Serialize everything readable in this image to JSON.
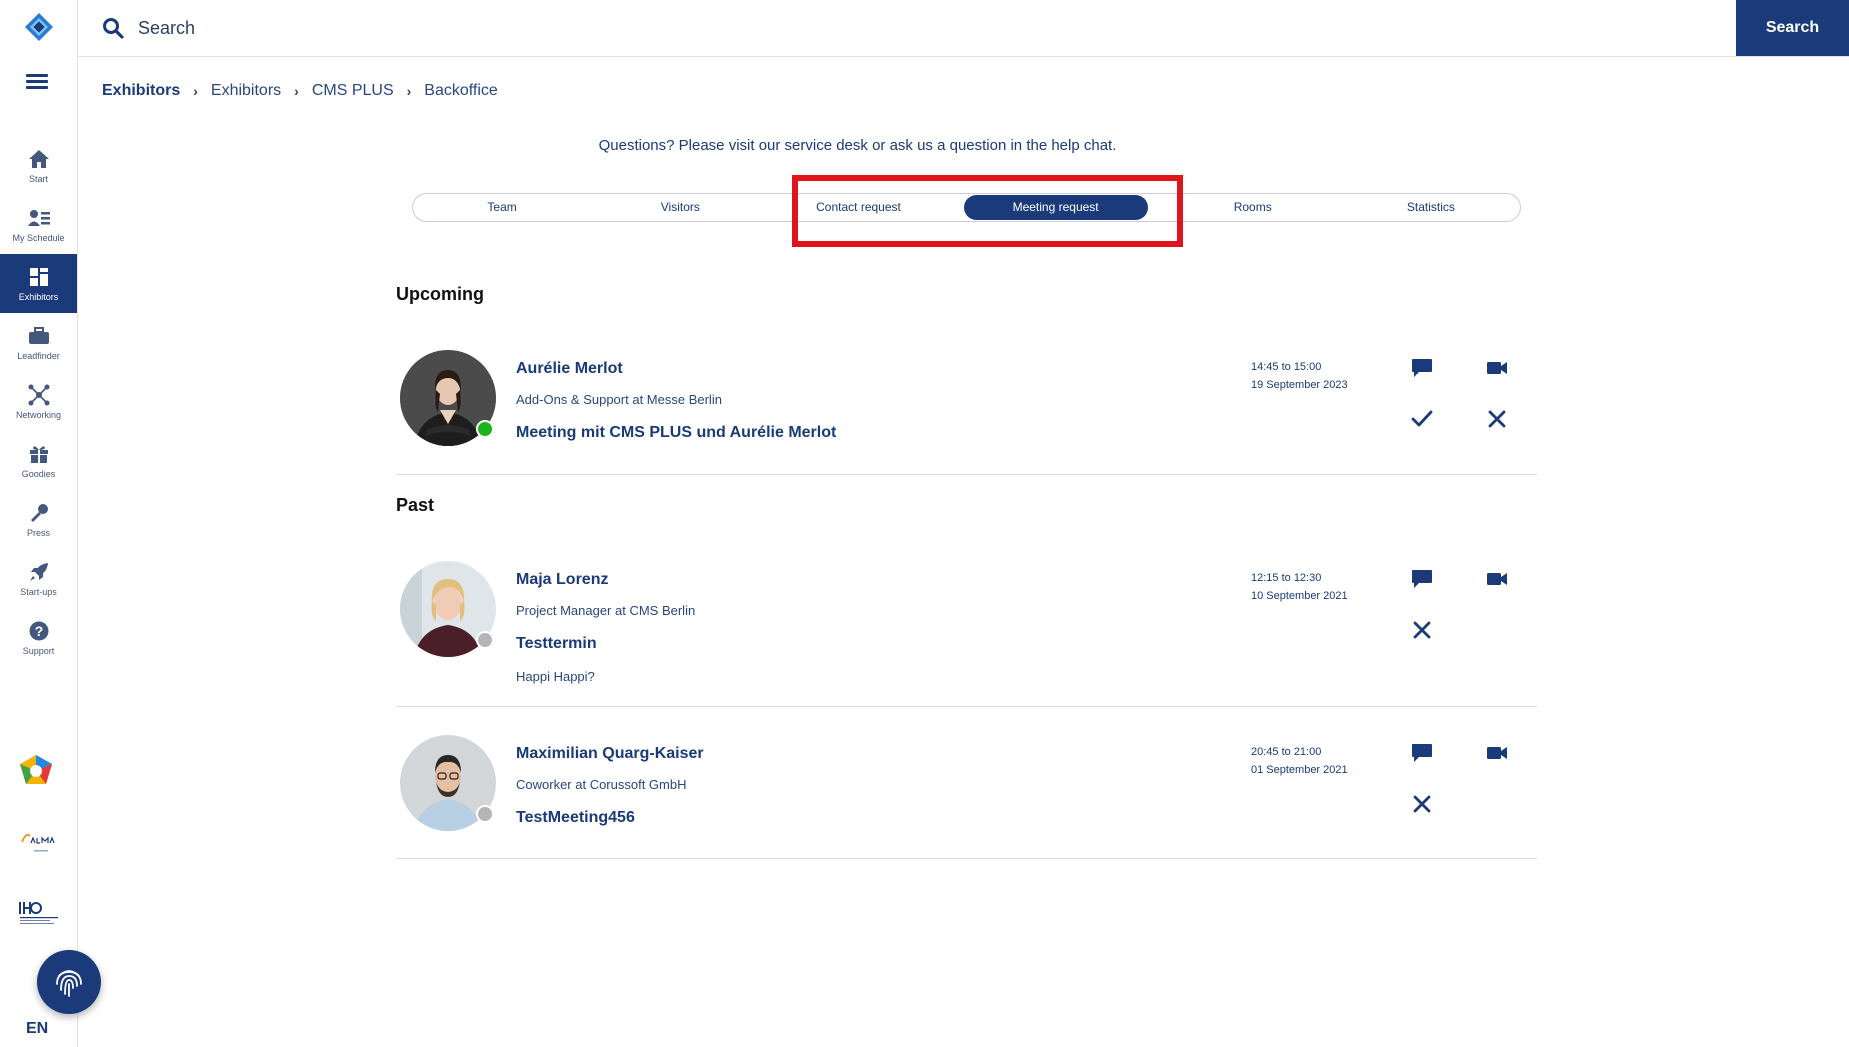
{
  "app": {
    "language": "EN"
  },
  "search": {
    "placeholder": "Search",
    "button_label": "Search"
  },
  "sidebar": {
    "items": [
      {
        "label": "Start",
        "icon": "home-icon"
      },
      {
        "label": "My Schedule",
        "icon": "schedule-icon"
      },
      {
        "label": "Exhibitors",
        "icon": "exhibitors-icon",
        "active": true
      },
      {
        "label": "Leadfinder",
        "icon": "briefcase-icon"
      },
      {
        "label": "Networking",
        "icon": "network-icon"
      },
      {
        "label": "Goodies",
        "icon": "gift-icon"
      },
      {
        "label": "Press",
        "icon": "microphone-icon"
      },
      {
        "label": "Start-ups",
        "icon": "rocket-icon"
      },
      {
        "label": "Support",
        "icon": "help-icon"
      }
    ]
  },
  "breadcrumb": [
    "Exhibitors",
    "Exhibitors",
    "CMS PLUS",
    "Backoffice"
  ],
  "help_text": "Questions? Please visit our service desk or ask us a question in the help chat.",
  "tabs": [
    "Team",
    "Visitors",
    "Contact request",
    "Meeting request",
    "Rooms",
    "Statistics"
  ],
  "active_tab": "Meeting request",
  "sections": {
    "upcoming": {
      "title": "Upcoming",
      "meetings": [
        {
          "name": "Aurélie Merlot",
          "role": "Add-Ons & Support at Messe Berlin",
          "title": "Meeting mit CMS PLUS und Aurélie Merlot",
          "time": "14:45 to 15:00",
          "date": "19 September 2023",
          "online": true
        }
      ]
    },
    "past": {
      "title": "Past",
      "meetings": [
        {
          "name": "Maja Lorenz",
          "role": "Project Manager at CMS Berlin",
          "title": "Testtermin",
          "note": "Happi Happi?",
          "time": "12:15 to 12:30",
          "date": "10 September 2021",
          "online": false
        },
        {
          "name": "Maximilian Quarg-Kaiser",
          "role": "Coworker at Corussoft GmbH",
          "title": "TestMeeting456",
          "time": "20:45 to 21:00",
          "date": "01 September 2021",
          "online": false
        }
      ]
    }
  },
  "colors": {
    "primary": "#1a3a7a",
    "highlight": "#e0141c",
    "online": "#1db31d",
    "offline": "#b5b5b5"
  }
}
